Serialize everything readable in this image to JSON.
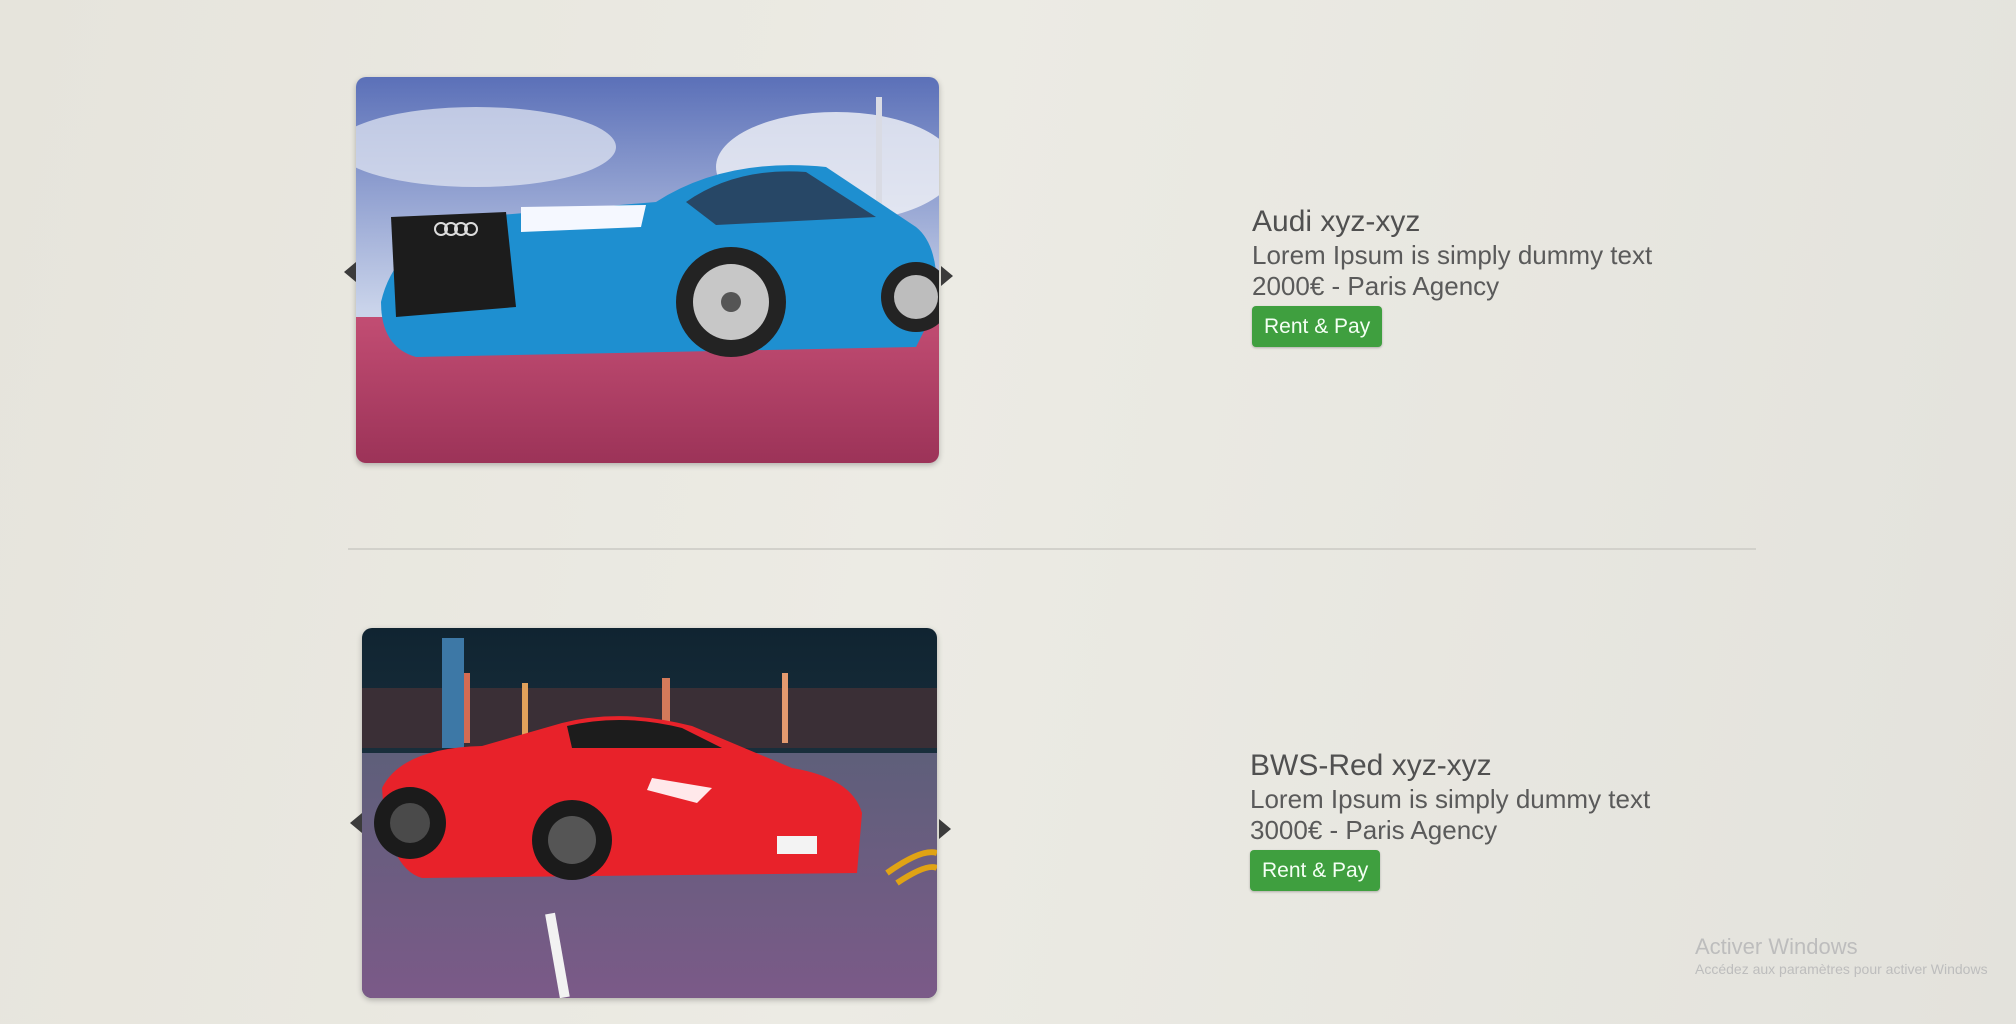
{
  "listings": [
    {
      "title": "Audi xyz-xyz",
      "description": "Lorem Ipsum is simply dummy text",
      "price_location": "2000€ - Paris Agency",
      "button_label": "Rent & Pay",
      "image_subject": "blue Audi sedan",
      "colors": {
        "car": "#1e8fd0",
        "button": "#3f9f3f"
      }
    },
    {
      "title": "BWS-Red xyz-xyz",
      "description": "Lorem Ipsum is simply dummy text",
      "price_location": "3000€ - Paris Agency",
      "button_label": "Rent & Pay",
      "image_subject": "red Ferrari coupe",
      "colors": {
        "car": "#e8222a",
        "button": "#3f9f3f"
      }
    }
  ],
  "watermark": {
    "title": "Activer Windows",
    "subtitle": "Accédez aux paramètres pour activer Windows"
  }
}
